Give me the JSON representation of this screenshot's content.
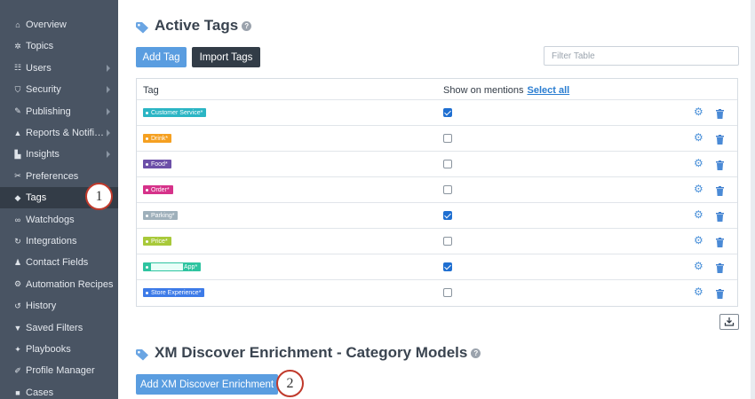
{
  "sidebar": {
    "items": [
      {
        "label": "Overview",
        "icon": "home-icon",
        "glyph": "⌂",
        "chevron": false,
        "active": false
      },
      {
        "label": "Topics",
        "icon": "topics-icon",
        "glyph": "✲",
        "chevron": false,
        "active": false
      },
      {
        "label": "Users",
        "icon": "users-icon",
        "glyph": "☷",
        "chevron": true,
        "active": false
      },
      {
        "label": "Security",
        "icon": "shield-icon",
        "glyph": "⛉",
        "chevron": true,
        "active": false
      },
      {
        "label": "Publishing",
        "icon": "publishing-icon",
        "glyph": "✎",
        "chevron": true,
        "active": false
      },
      {
        "label": "Reports & Notifi…",
        "icon": "warning-icon",
        "glyph": "▲",
        "chevron": true,
        "active": false
      },
      {
        "label": "Insights",
        "icon": "chart-icon",
        "glyph": "▙",
        "chevron": true,
        "active": false
      },
      {
        "label": "Preferences",
        "icon": "wrench-icon",
        "glyph": "✂",
        "chevron": false,
        "active": false
      },
      {
        "label": "Tags",
        "icon": "tag-icon",
        "glyph": "◆",
        "chevron": false,
        "active": true
      },
      {
        "label": "Watchdogs",
        "icon": "binoculars-icon",
        "glyph": "∞",
        "chevron": false,
        "active": false
      },
      {
        "label": "Integrations",
        "icon": "refresh-icon",
        "glyph": "↻",
        "chevron": false,
        "active": false
      },
      {
        "label": "Contact Fields",
        "icon": "person-icon",
        "glyph": "♟",
        "chevron": false,
        "active": false
      },
      {
        "label": "Automation Recipes",
        "icon": "recipes-icon",
        "glyph": "⚙",
        "chevron": false,
        "active": false
      },
      {
        "label": "History",
        "icon": "history-icon",
        "glyph": "↺",
        "chevron": false,
        "active": false
      },
      {
        "label": "Saved Filters",
        "icon": "filter-icon",
        "glyph": "▼",
        "chevron": false,
        "active": false
      },
      {
        "label": "Playbooks",
        "icon": "playbook-icon",
        "glyph": "✦",
        "chevron": false,
        "active": false
      },
      {
        "label": "Profile Manager",
        "icon": "pencil-icon",
        "glyph": "✐",
        "chevron": false,
        "active": false
      },
      {
        "label": "Cases",
        "icon": "briefcase-icon",
        "glyph": "■",
        "chevron": false,
        "active": false
      }
    ]
  },
  "active_tags": {
    "title": "Active Tags",
    "help": "?",
    "add_tag_label": "Add Tag",
    "import_tags_label": "Import Tags",
    "filter_placeholder": "Filter Table",
    "columns": {
      "tag": "Tag",
      "show_on_mentions": "Show on mentions",
      "select_all": "Select all"
    },
    "rows": [
      {
        "name": "Customer Service*",
        "color": "#2bb5c4",
        "checked": true
      },
      {
        "name": "Drink*",
        "color": "#f5a021",
        "checked": false
      },
      {
        "name": "Food*",
        "color": "#6c4fa8",
        "checked": false
      },
      {
        "name": "Order*",
        "color": "#d6328a",
        "checked": false
      },
      {
        "name": "Parking*",
        "color": "#9fb0bb",
        "checked": true
      },
      {
        "name": "Price*",
        "color": "#a8c93a",
        "checked": false
      },
      {
        "name": "App*",
        "color": "#2ec4a0",
        "checked": true
      },
      {
        "name": "Store Experience*",
        "color": "#3d7be8",
        "checked": false
      }
    ]
  },
  "enrichment": {
    "title": "XM Discover Enrichment - Category Models",
    "help": "?",
    "add_label": "Add XM Discover Enrichment"
  },
  "callouts": [
    "1",
    "2"
  ],
  "colors": {
    "accent": "#5a9de0",
    "dark_button": "#323c47",
    "sidebar": "#495463",
    "callout_border": "#c0392b"
  }
}
